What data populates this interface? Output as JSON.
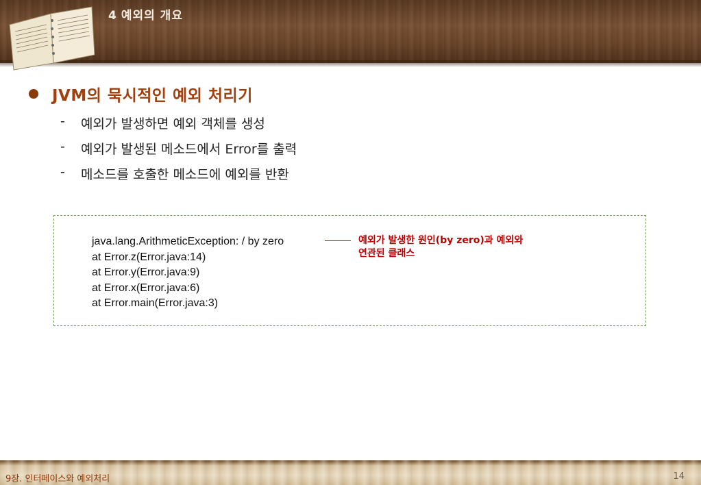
{
  "header": {
    "number": "4",
    "title": "예외의 개요"
  },
  "main": {
    "heading": "JVM의 묵시적인 예외 처리기",
    "items": [
      {
        "dash": "-",
        "text": "예외가 발생하면 예외 객체를 생성"
      },
      {
        "dash": "-",
        "text": "예외가 발생된 메소드에서 Error를 출력"
      },
      {
        "dash": "-",
        "text": "메소드를 호출한 메소드에 예외를 반환"
      }
    ]
  },
  "code_box": {
    "lines": [
      "java.lang.ArithmeticException: / by zero",
      "at Error.z(Error.java:14)",
      "at Error.y(Error.java:9)",
      "at Error.x(Error.java:6)",
      "at Error.main(Error.java:3)"
    ],
    "annotation": [
      "예외가 발생한 원인(by zero)과 예외와",
      "연관된 클래스"
    ]
  },
  "footer": {
    "chapter": "9장. 인터페이스와 예외처리",
    "page": "14"
  },
  "colors": {
    "heading": "#a0400e",
    "bullet": "#8b3a0c",
    "annotation": "#c00000",
    "box_border": "#7a9a5a"
  }
}
